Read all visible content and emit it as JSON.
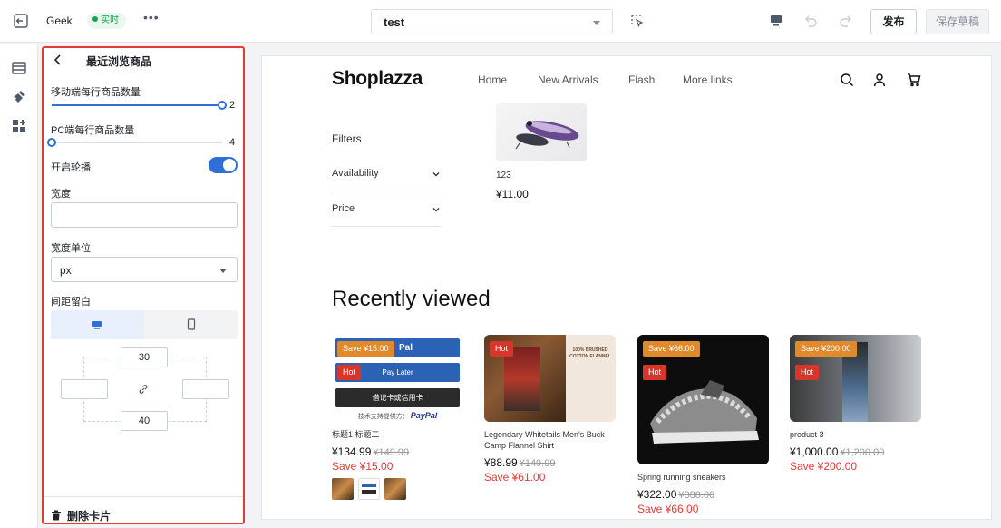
{
  "topbar": {
    "site_name": "Geek",
    "status_badge": "实时",
    "more": "•••",
    "page_select": "test",
    "publish": "发布",
    "save_draft": "保存草稿"
  },
  "panel": {
    "title": "最近浏览商品",
    "mobile_per_row_label": "移动端每行商品数量",
    "mobile_per_row_value": "2",
    "mobile_per_row_level": 1.0,
    "pc_per_row_label": "PC端每行商品数量",
    "pc_per_row_value": "4",
    "pc_per_row_level": 0.0,
    "carousel_label": "开启轮播",
    "carousel_on": true,
    "width_label": "宽度",
    "width_value": "",
    "width_unit_label": "宽度单位",
    "width_unit_value": "px",
    "spacing_label": "间距留白",
    "spacing_top": "30",
    "spacing_bottom": "40",
    "spacing_left": "",
    "spacing_right": "",
    "delete_label": "删除卡片"
  },
  "store": {
    "logo": "Shoplazza",
    "nav": [
      "Home",
      "New Arrivals",
      "Flash",
      "More links"
    ],
    "filters_label": "Filters",
    "facets": [
      "Availability",
      "Price"
    ],
    "product_name": "123",
    "product_price": "¥11.00",
    "recently_viewed_title": "Recently viewed",
    "cards": [
      {
        "save_tag": "Save ¥15.00",
        "hot_tag": "Hot",
        "name": "标题1 标题二",
        "price": "¥134.99",
        "compare": "¥149.99",
        "save": "Save ¥15.00",
        "paypal_label": "Pay Later",
        "paypal_card": "借记卡或信用卡",
        "paypal_footer": "技术支持提供方：",
        "paypal_brand": "PayPal",
        "paypal_top": "Pal"
      },
      {
        "save_tag": "",
        "hot_tag": "Hot",
        "name": "Legendary Whitetails Men's Buck Camp Flannel Shirt",
        "price": "¥88.99",
        "compare": "¥149.99",
        "save": "Save ¥61.00",
        "flannel_text": "100% BRUSHED COTTON FLANNEL"
      },
      {
        "save_tag": "Save ¥66.00",
        "hot_tag": "Hot",
        "name": "Spring running sneakers",
        "price": "¥322.00",
        "compare": "¥388.00",
        "save": "Save ¥66.00"
      },
      {
        "save_tag": "Save ¥200.00",
        "hot_tag": "Hot",
        "name": "product 3",
        "price": "¥1,000.00",
        "compare": "¥1,200.00",
        "save": "Save ¥200.00"
      }
    ]
  }
}
